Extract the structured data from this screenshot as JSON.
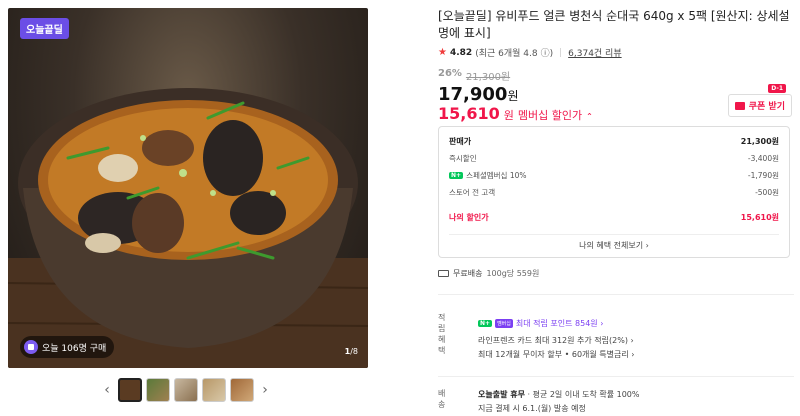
{
  "gallery": {
    "badge": "오늘끝딜",
    "buyers": "오늘 106명 구매",
    "page": "1",
    "page_total": "/8"
  },
  "product": {
    "title": "[오늘끝딜] 유비푸드 얼큰 병천식 순대국 640g x 5팩 [원산지: 상세설명에 표시]",
    "rating": "4.82",
    "rating_note": "(최근 6개월 4.8",
    "reviews": "6,374건 리뷰",
    "discount_pct": "26%",
    "original_price": "21,300원",
    "price": "17,900",
    "price_unit": "원",
    "member_price": "15,610",
    "member_price_unit": "원",
    "member_label": "멤버십 할인가",
    "coupon_label": "쿠폰 받기",
    "coupon_badge": "D-1"
  },
  "breakdown": {
    "rows": [
      {
        "label": "판매가",
        "value": "21,300원"
      },
      {
        "label": "즉시할인",
        "value": "-3,400원"
      },
      {
        "label": "스페셜멤버십 10%",
        "value": "-1,790원"
      },
      {
        "label": "스토어 전 고객",
        "value": "-500원"
      }
    ],
    "np_badge": "N+",
    "mine_label": "나의 할인가",
    "mine_value": "15,610원",
    "more": "나의 혜택 전체보기 ›"
  },
  "shipping": {
    "label": "무료배송",
    "sub": "100g당 559원"
  },
  "points": {
    "key": "적립",
    "np": "N+",
    "mem": "멤버십",
    "text": "최대 적립 포인트 854원 ›"
  },
  "benefit": {
    "key": "혜택",
    "line1": "라인프렌즈 카드 최대 312원 추가 적립(2%) ›",
    "line2": "최대 12개월 무이자 할부 • 60개월 특별금리 ›"
  },
  "delivery": {
    "key": "배송",
    "line1_bold": "오늘출발 휴무",
    "line1_rest": " · 평균 2일 이내 도착 확률 100%",
    "line2": "지금 결제 시 6.1.(월) 발송 예정"
  }
}
